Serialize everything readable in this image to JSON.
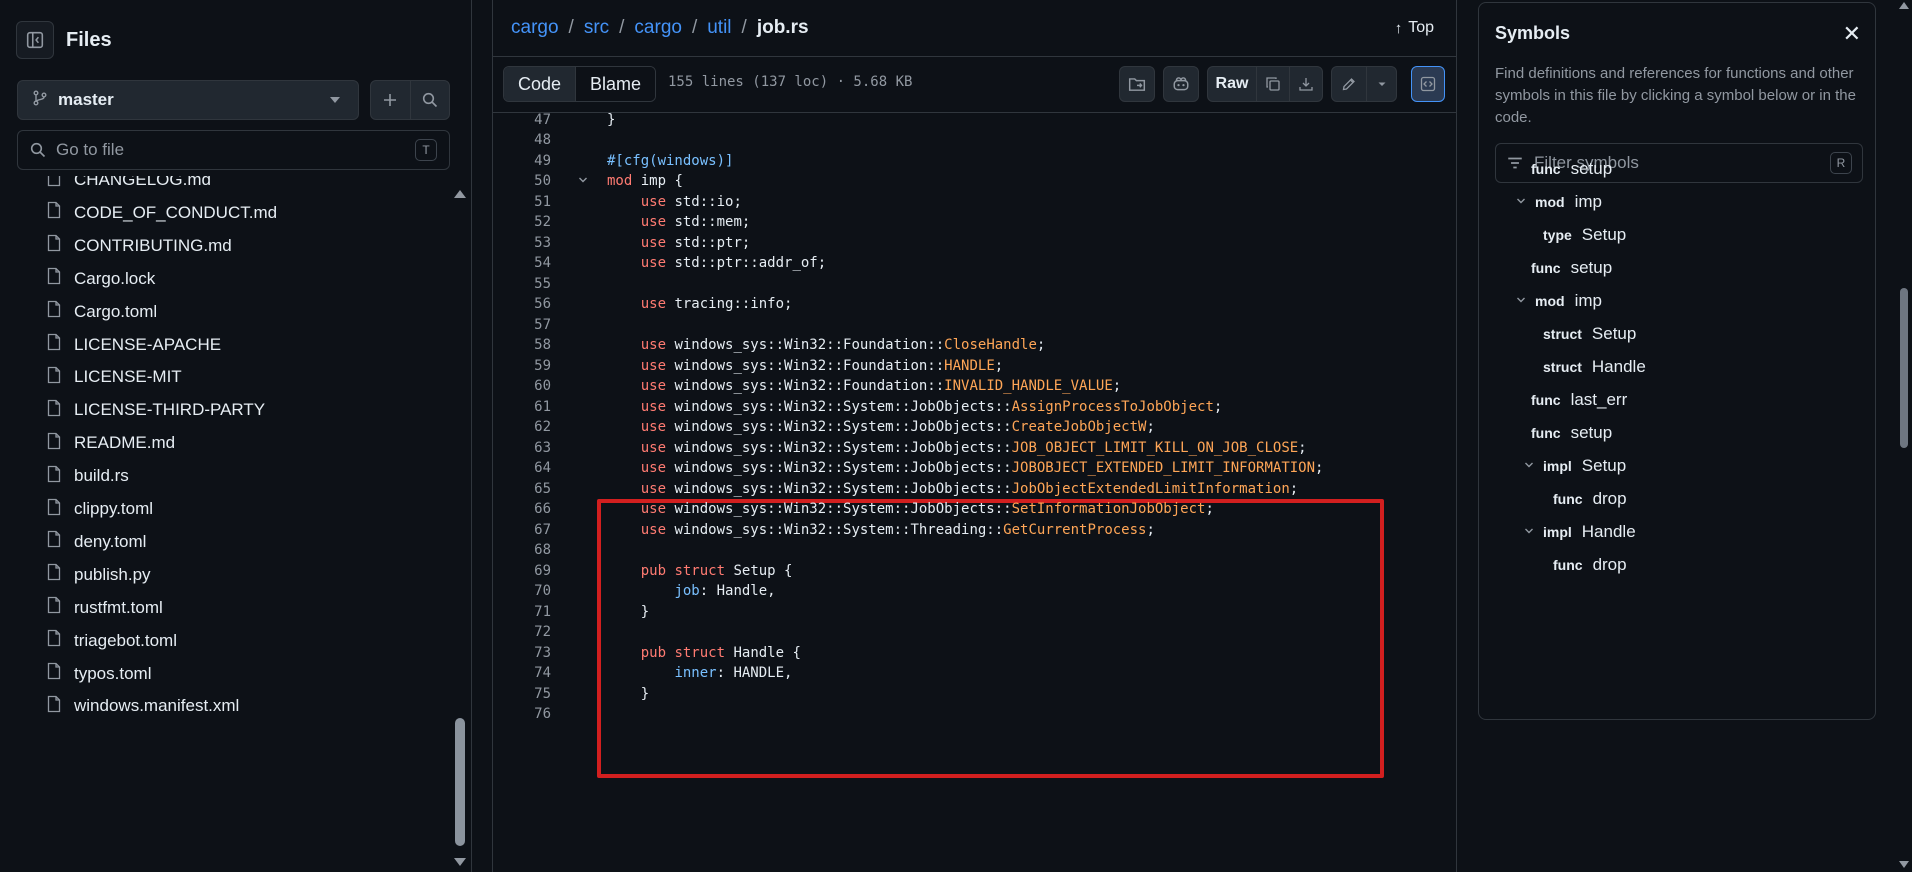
{
  "sidebar": {
    "title": "Files",
    "branch": "master",
    "goto_placeholder": "Go to file",
    "goto_shortcut": "T",
    "files": [
      "CHANGELOG.md",
      "CODE_OF_CONDUCT.md",
      "CONTRIBUTING.md",
      "Cargo.lock",
      "Cargo.toml",
      "LICENSE-APACHE",
      "LICENSE-MIT",
      "LICENSE-THIRD-PARTY",
      "README.md",
      "build.rs",
      "clippy.toml",
      "deny.toml",
      "publish.py",
      "rustfmt.toml",
      "triagebot.toml",
      "typos.toml",
      "windows.manifest.xml"
    ]
  },
  "header": {
    "crumbs": [
      "cargo",
      "src",
      "cargo",
      "util"
    ],
    "separator": "/",
    "current_file": "job.rs",
    "top_label": "Top"
  },
  "toolbar": {
    "code_tab": "Code",
    "blame_tab": "Blame",
    "file_meta": "155 lines (137 loc) · 5.68 KB",
    "raw_label": "Raw"
  },
  "code": {
    "lines": [
      {
        "n": "47",
        "fold": "",
        "t": [
          [
            "p",
            "}"
          ]
        ]
      },
      {
        "n": "48",
        "fold": "",
        "t": []
      },
      {
        "n": "49",
        "fold": "",
        "t": [
          [
            "a",
            "#[cfg(windows)]"
          ]
        ]
      },
      {
        "n": "50",
        "fold": "v",
        "t": [
          [
            "k",
            "mod"
          ],
          [
            "p",
            " imp {"
          ]
        ]
      },
      {
        "n": "51",
        "fold": "",
        "t": [
          [
            "p",
            "    "
          ],
          [
            "k",
            "use"
          ],
          [
            "p",
            " std::io;"
          ]
        ]
      },
      {
        "n": "52",
        "fold": "",
        "t": [
          [
            "p",
            "    "
          ],
          [
            "k",
            "use"
          ],
          [
            "p",
            " std::mem;"
          ]
        ]
      },
      {
        "n": "53",
        "fold": "",
        "t": [
          [
            "p",
            "    "
          ],
          [
            "k",
            "use"
          ],
          [
            "p",
            " std::ptr;"
          ]
        ]
      },
      {
        "n": "54",
        "fold": "",
        "t": [
          [
            "p",
            "    "
          ],
          [
            "k",
            "use"
          ],
          [
            "p",
            " std::ptr::addr_of;"
          ]
        ]
      },
      {
        "n": "55",
        "fold": "",
        "t": []
      },
      {
        "n": "56",
        "fold": "",
        "t": [
          [
            "p",
            "    "
          ],
          [
            "k",
            "use"
          ],
          [
            "p",
            " tracing::info;"
          ]
        ]
      },
      {
        "n": "57",
        "fold": "",
        "t": []
      },
      {
        "n": "58",
        "fold": "",
        "t": [
          [
            "p",
            "    "
          ],
          [
            "k",
            "use"
          ],
          [
            "p",
            " windows_sys::Win32::Foundation::"
          ],
          [
            "y",
            "CloseHandle"
          ],
          [
            "p",
            ";"
          ]
        ]
      },
      {
        "n": "59",
        "fold": "",
        "t": [
          [
            "p",
            "    "
          ],
          [
            "k",
            "use"
          ],
          [
            "p",
            " windows_sys::Win32::Foundation::"
          ],
          [
            "y",
            "HANDLE"
          ],
          [
            "p",
            ";"
          ]
        ]
      },
      {
        "n": "60",
        "fold": "",
        "t": [
          [
            "p",
            "    "
          ],
          [
            "k",
            "use"
          ],
          [
            "p",
            " windows_sys::Win32::Foundation::"
          ],
          [
            "y",
            "INVALID_HANDLE_VALUE"
          ],
          [
            "p",
            ";"
          ]
        ]
      },
      {
        "n": "61",
        "fold": "",
        "t": [
          [
            "p",
            "    "
          ],
          [
            "k",
            "use"
          ],
          [
            "p",
            " windows_sys::Win32::System::JobObjects::"
          ],
          [
            "y",
            "AssignProcessToJobObject"
          ],
          [
            "p",
            ";"
          ]
        ]
      },
      {
        "n": "62",
        "fold": "",
        "t": [
          [
            "p",
            "    "
          ],
          [
            "k",
            "use"
          ],
          [
            "p",
            " windows_sys::Win32::System::JobObjects::"
          ],
          [
            "y",
            "CreateJobObjectW"
          ],
          [
            "p",
            ";"
          ]
        ]
      },
      {
        "n": "63",
        "fold": "",
        "t": [
          [
            "p",
            "    "
          ],
          [
            "k",
            "use"
          ],
          [
            "p",
            " windows_sys::Win32::System::JobObjects::"
          ],
          [
            "y",
            "JOB_OBJECT_LIMIT_KILL_ON_JOB_CLOSE"
          ],
          [
            "p",
            ";"
          ]
        ]
      },
      {
        "n": "64",
        "fold": "",
        "t": [
          [
            "p",
            "    "
          ],
          [
            "k",
            "use"
          ],
          [
            "p",
            " windows_sys::Win32::System::JobObjects::"
          ],
          [
            "y",
            "JOBOBJECT_EXTENDED_LIMIT_INFORMATION"
          ],
          [
            "p",
            ";"
          ]
        ]
      },
      {
        "n": "65",
        "fold": "",
        "t": [
          [
            "p",
            "    "
          ],
          [
            "k",
            "use"
          ],
          [
            "p",
            " windows_sys::Win32::System::JobObjects::"
          ],
          [
            "y",
            "JobObjectExtendedLimitInformation"
          ],
          [
            "p",
            ";"
          ]
        ]
      },
      {
        "n": "66",
        "fold": "",
        "t": [
          [
            "p",
            "    "
          ],
          [
            "k",
            "use"
          ],
          [
            "p",
            " windows_sys::Win32::System::JobObjects::"
          ],
          [
            "y",
            "SetInformationJobObject"
          ],
          [
            "p",
            ";"
          ]
        ]
      },
      {
        "n": "67",
        "fold": "",
        "t": [
          [
            "p",
            "    "
          ],
          [
            "k",
            "use"
          ],
          [
            "p",
            " windows_sys::Win32::System::Threading::"
          ],
          [
            "y",
            "GetCurrentProcess"
          ],
          [
            "p",
            ";"
          ]
        ]
      },
      {
        "n": "68",
        "fold": "",
        "t": []
      },
      {
        "n": "69",
        "fold": "",
        "t": [
          [
            "p",
            "    "
          ],
          [
            "k",
            "pub"
          ],
          [
            "p",
            " "
          ],
          [
            "k",
            "struct"
          ],
          [
            "p",
            " Setup {"
          ]
        ]
      },
      {
        "n": "70",
        "fold": "",
        "t": [
          [
            "p",
            "        "
          ],
          [
            "a",
            "job"
          ],
          [
            "p",
            ": Handle,"
          ]
        ]
      },
      {
        "n": "71",
        "fold": "",
        "t": [
          [
            "p",
            "    }"
          ]
        ]
      },
      {
        "n": "72",
        "fold": "",
        "t": []
      },
      {
        "n": "73",
        "fold": "",
        "t": [
          [
            "p",
            "    "
          ],
          [
            "k",
            "pub"
          ],
          [
            "p",
            " "
          ],
          [
            "k",
            "struct"
          ],
          [
            "p",
            " Handle {"
          ]
        ]
      },
      {
        "n": "74",
        "fold": "",
        "t": [
          [
            "p",
            "        "
          ],
          [
            "a",
            "inner"
          ],
          [
            "p",
            ": HANDLE,"
          ]
        ]
      },
      {
        "n": "75",
        "fold": "",
        "t": [
          [
            "p",
            "    }"
          ]
        ]
      },
      {
        "n": "76",
        "fold": "",
        "t": []
      }
    ],
    "highlighted_lines": [
      "58",
      "67"
    ]
  },
  "symbols": {
    "title": "Symbols",
    "description": "Find definitions and references for functions and other symbols in this file by clicking a symbol below or in the code.",
    "filter_placeholder": "Filter symbols",
    "filter_shortcut": "R",
    "items": [
      {
        "kind": "func",
        "name": "setup",
        "level": 1,
        "expanded": false
      },
      {
        "kind": "mod",
        "name": "imp",
        "level": 0,
        "expanded": true
      },
      {
        "kind": "type",
        "name": "Setup",
        "level": 1,
        "expanded": false
      },
      {
        "kind": "func",
        "name": "setup",
        "level": 1,
        "expanded": false
      },
      {
        "kind": "mod",
        "name": "imp",
        "level": 0,
        "expanded": true
      },
      {
        "kind": "struct",
        "name": "Setup",
        "level": 1,
        "expanded": false
      },
      {
        "kind": "struct",
        "name": "Handle",
        "level": 1,
        "expanded": false
      },
      {
        "kind": "func",
        "name": "last_err",
        "level": 1,
        "expanded": false
      },
      {
        "kind": "func",
        "name": "setup",
        "level": 1,
        "expanded": false
      },
      {
        "kind": "impl",
        "name": "Setup",
        "level": 1,
        "expanded": true
      },
      {
        "kind": "func",
        "name": "drop",
        "level": 2,
        "expanded": false
      },
      {
        "kind": "impl",
        "name": "Handle",
        "level": 1,
        "expanded": true
      },
      {
        "kind": "func",
        "name": "drop",
        "level": 2,
        "expanded": false
      }
    ]
  },
  "colors": {
    "background": "#0d1117",
    "border": "#30363d",
    "link": "#4493f8",
    "keyword": "#ff7b72",
    "type": "#ffa657",
    "attribute": "#79c0ff",
    "highlight_box": "#d21f1f"
  },
  "icons": {
    "sidebar_toggle": "sidebar-collapse-icon",
    "branch": "git-branch-icon",
    "file": "file-icon"
  }
}
